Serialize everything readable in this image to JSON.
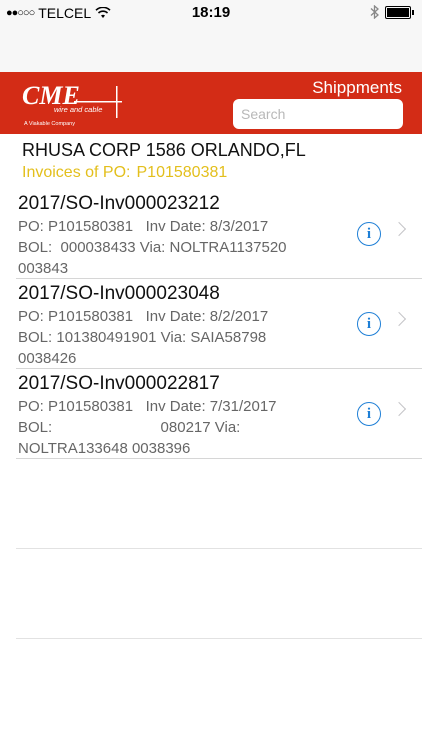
{
  "status_bar": {
    "signal": "●●○○○",
    "carrier": "TELCEL",
    "time": "18:19",
    "wifi_icon": "wifi-icon",
    "bluetooth_icon": "bluetooth-icon",
    "battery_icon": "battery-icon"
  },
  "header": {
    "logo_text": "CME",
    "logo_sub": "wire and cable",
    "logo_tagline": "A Viakable Company",
    "shipments_label": "Shippments",
    "search_placeholder": "Search",
    "background_color": "#d32c16"
  },
  "customer": {
    "name": "RHUSA CORP 1586 ORLANDO,FL",
    "invoices_label": "Invoices of PO:",
    "po_number": "P101580381",
    "accent_color": "#e3bf1c"
  },
  "invoices": [
    {
      "title": "2017/SO-Inv000023212",
      "line1": "PO: P101580381   Inv Date: 8/3/2017",
      "line2": "BOL:  000038433 Via: NOLTRA1137520",
      "line3": "003843"
    },
    {
      "title": "2017/SO-Inv000023048",
      "line1": "PO: P101580381   Inv Date: 8/2/2017",
      "line2": "BOL: 101380491901 Via: SAIA58798",
      "line3": "0038426"
    },
    {
      "title": "2017/SO-Inv000022817",
      "line1": "PO: P101580381   Inv Date: 7/31/2017",
      "line2": "BOL:                          080217 Via:",
      "line3": "NOLTRA133648 0038396"
    }
  ],
  "row_icons": {
    "info": "i",
    "info_icon": "info-icon",
    "chevron_icon": "chevron-right-icon"
  }
}
